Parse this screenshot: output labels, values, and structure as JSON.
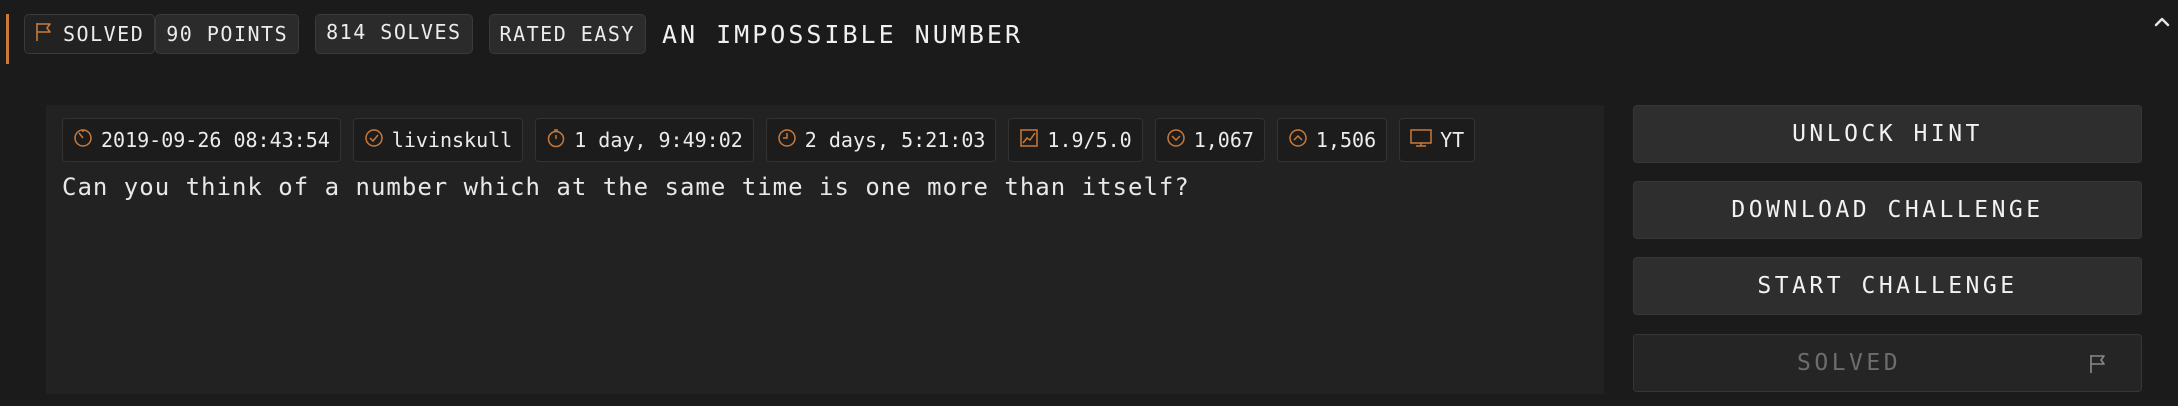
{
  "header": {
    "solved_label": "SOLVED",
    "points_label": "90 POINTS",
    "solves_label": "814 SOLVES",
    "rated_label": "RATED EASY",
    "title": "AN IMPOSSIBLE NUMBER"
  },
  "meta": {
    "date": "2019-09-26 08:43:54",
    "author": "livinskull",
    "first_blood": "1 day, 9:49:02",
    "duration": "2 days, 5:21:03",
    "rating": "1.9/5.0",
    "downvotes": "1,067",
    "upvotes": "1,506",
    "category": "YT"
  },
  "description": "Can you think of a number which at the same time is one more than itself?",
  "actions": {
    "unlock_hint": "UNLOCK HINT",
    "download": "DOWNLOAD CHALLENGE",
    "start": "START CHALLENGE",
    "solved": "SOLVED"
  },
  "colors": {
    "accent": "#c97a3a",
    "background": "#1b1b1b",
    "card": "#222222",
    "button": "#2e2e2e"
  },
  "icons": [
    "flag-icon",
    "clock-icon",
    "check-circle-icon",
    "stopwatch-icon",
    "timer-icon",
    "chart-icon",
    "chevron-down-circle-icon",
    "chevron-up-circle-icon",
    "monitor-icon",
    "chevron-up-icon"
  ]
}
